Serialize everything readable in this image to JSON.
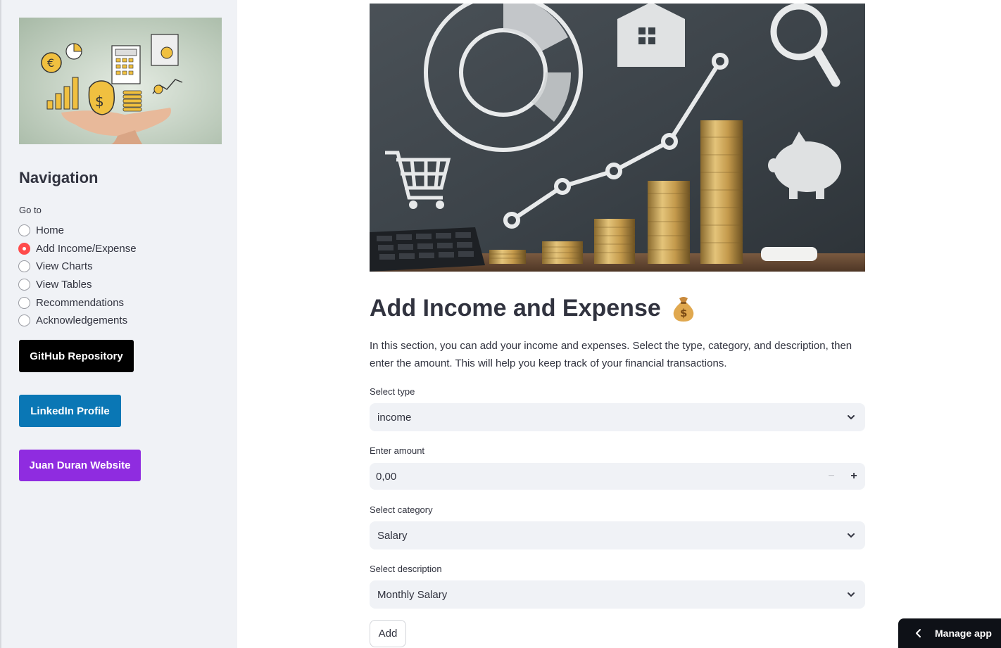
{
  "sidebar": {
    "image_alt": "hand holding finance icons",
    "nav_title": "Navigation",
    "goto_label": "Go to",
    "options": [
      {
        "label": "Home",
        "selected": false
      },
      {
        "label": "Add Income/Expense",
        "selected": true
      },
      {
        "label": "View Charts",
        "selected": false
      },
      {
        "label": "View Tables",
        "selected": false
      },
      {
        "label": "Recommendations",
        "selected": false
      },
      {
        "label": "Acknowledgements",
        "selected": false
      }
    ],
    "buttons": {
      "github": "GitHub Repository",
      "linkedin": "LinkedIn Profile",
      "website": "Juan Duran Website"
    },
    "colors": {
      "selected_radio": "#ff4b4b",
      "github_btn": "#000000",
      "linkedin_btn": "#0a77b5",
      "website_btn": "#8f2ce0"
    }
  },
  "main": {
    "hero_alt": "finance chalkboard with coin stacks",
    "title": "Add Income and Expense",
    "title_icon": "money-bag-icon",
    "intro": "In this section, you can add your income and expenses. Select the type, category, and description, then enter the amount. This will help you keep track of your financial transactions.",
    "type": {
      "label": "Select type",
      "value": "income"
    },
    "amount": {
      "label": "Enter amount",
      "value": "0,00",
      "minus": "−",
      "plus": "+"
    },
    "category": {
      "label": "Select category",
      "value": "Salary"
    },
    "description": {
      "label": "Select description",
      "value": "Monthly Salary"
    },
    "add_label": "Add"
  },
  "footer": {
    "manage_app": "Manage app"
  }
}
